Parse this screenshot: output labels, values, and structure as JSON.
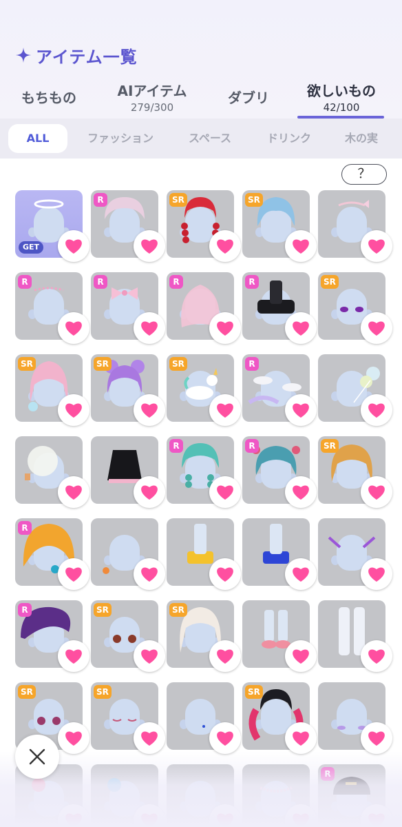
{
  "header": {
    "title": "アイテム一覧",
    "title_icon": "sparkle-icon",
    "accent_color": "#5b55cf"
  },
  "main_tabs": [
    {
      "label": "もちもの",
      "count": ""
    },
    {
      "label": "AIアイテム",
      "count": "279/300"
    },
    {
      "label": "ダブリ",
      "count": ""
    },
    {
      "label": "欲しいもの",
      "count": "42/100",
      "active": true
    }
  ],
  "sub_tabs": [
    {
      "label": "ALL",
      "active": true
    },
    {
      "label": "ファッション"
    },
    {
      "label": "スペース"
    },
    {
      "label": "ドリンク"
    },
    {
      "label": "木の実"
    }
  ],
  "help_label": "？",
  "get_label": "GET",
  "heart_color": "#ff4fa0",
  "items": [
    {
      "rarity": "",
      "owned": true,
      "deco": "halo"
    },
    {
      "rarity": "R",
      "deco": "bonnet-pink"
    },
    {
      "rarity": "SR",
      "deco": "red-braids"
    },
    {
      "rarity": "SR",
      "deco": "blue-hair"
    },
    {
      "rarity": "",
      "deco": "ribbon-headband"
    },
    {
      "rarity": "R",
      "deco": "pearl-band"
    },
    {
      "rarity": "R",
      "deco": "pink-bow"
    },
    {
      "rarity": "R",
      "deco": "pink-veil"
    },
    {
      "rarity": "R",
      "deco": "black-top"
    },
    {
      "rarity": "SR",
      "deco": "purple-eyes"
    },
    {
      "rarity": "SR",
      "deco": "rainbow-hair"
    },
    {
      "rarity": "SR",
      "deco": "purple-buns"
    },
    {
      "rarity": "SR",
      "deco": "unicorn"
    },
    {
      "rarity": "R",
      "deco": "clouds"
    },
    {
      "rarity": "",
      "deco": "balloons"
    },
    {
      "rarity": "",
      "deco": "bubble-balloon"
    },
    {
      "rarity": "",
      "deco": "black-dress"
    },
    {
      "rarity": "R",
      "deco": "teal-braids"
    },
    {
      "rarity": "R",
      "deco": "teal-hair"
    },
    {
      "rarity": "SR",
      "deco": "orange-hair"
    },
    {
      "rarity": "R",
      "deco": "orange-hood"
    },
    {
      "rarity": "",
      "deco": "earring"
    },
    {
      "rarity": "",
      "deco": "gold-skirt"
    },
    {
      "rarity": "",
      "deco": "blue-skirt"
    },
    {
      "rarity": "",
      "deco": "fork-pins"
    },
    {
      "rarity": "R",
      "deco": "purple-beret"
    },
    {
      "rarity": "SR",
      "deco": "brown-eyes"
    },
    {
      "rarity": "SR",
      "deco": "cream-curls"
    },
    {
      "rarity": "",
      "deco": "pink-shoes"
    },
    {
      "rarity": "",
      "deco": "white-tights"
    },
    {
      "rarity": "SR",
      "deco": "sparkle-eyes"
    },
    {
      "rarity": "SR",
      "deco": "sleepy-eyes"
    },
    {
      "rarity": "",
      "deco": "blue-mole"
    },
    {
      "rarity": "SR",
      "deco": "pink-twintails"
    },
    {
      "rarity": "",
      "deco": "purple-blush"
    },
    {
      "rarity": "",
      "deco": "pink-gloves"
    },
    {
      "rarity": "",
      "deco": "blue-glove"
    },
    {
      "rarity": "",
      "deco": "plain"
    },
    {
      "rarity": "",
      "deco": "pearl-necklace"
    },
    {
      "rarity": "R",
      "deco": "black-cap"
    }
  ]
}
